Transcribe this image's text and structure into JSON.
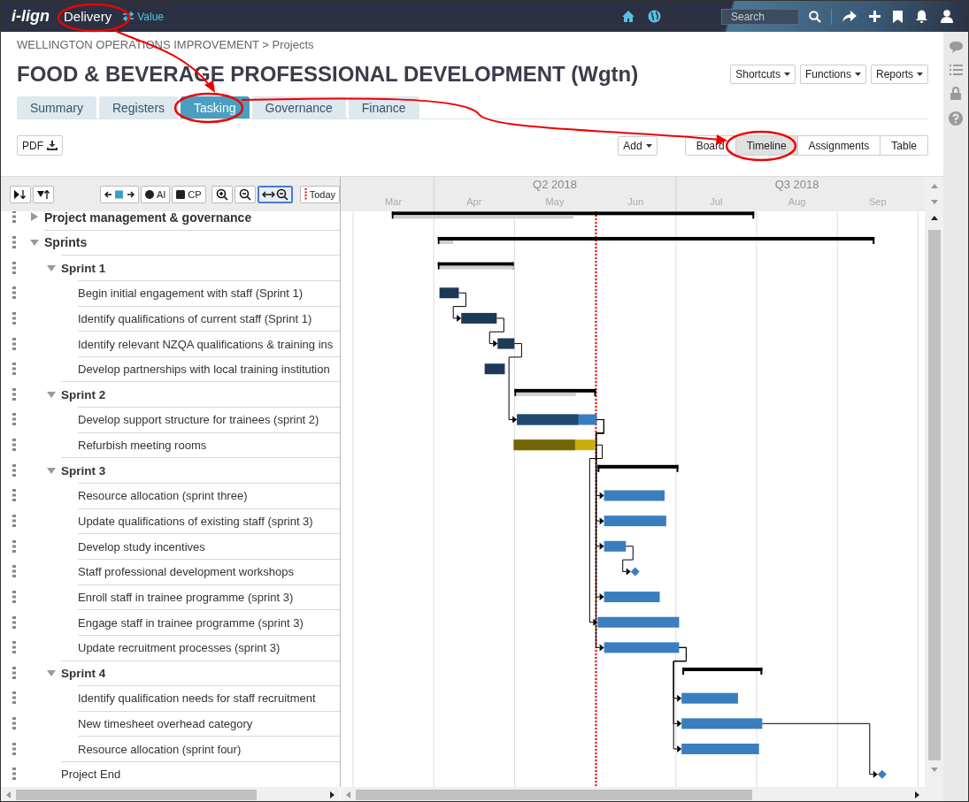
{
  "topbar": {
    "logo": "i-lign",
    "module": "Delivery",
    "switch_label": "Value",
    "search": {
      "placeholder": "Search"
    }
  },
  "breadcrumb": "WELLINGTON OPERATIONS IMPROVEMENT > Projects",
  "title": "FOOD & BEVERAGE PROFESSIONAL DEVELOPMENT (Wgtn)",
  "menus": [
    "Shortcuts",
    "Functions",
    "Reports"
  ],
  "tabs": [
    {
      "label": "Summary",
      "selected": false
    },
    {
      "label": "Registers",
      "selected": false
    },
    {
      "label": "Tasking",
      "selected": true
    },
    {
      "label": "Governance",
      "selected": false
    },
    {
      "label": "Finance",
      "selected": false
    }
  ],
  "pdf_button": "PDF",
  "add_button": "Add",
  "views": [
    {
      "label": "Board",
      "selected": false
    },
    {
      "label": "Timeline",
      "selected": true
    },
    {
      "label": "Assignments",
      "selected": false
    },
    {
      "label": "Table",
      "selected": false
    }
  ],
  "toolbar": {
    "ai_label": "AI",
    "cp_label": "CP",
    "today_label": "Today",
    "fit_selected": true
  },
  "tasks": [
    {
      "name": "Project management & governance",
      "kind": "summary",
      "expanded": false
    },
    {
      "name": "Sprints",
      "kind": "summary",
      "expanded": true,
      "children": [
        {
          "name": "Sprint 1",
          "kind": "summary",
          "expanded": true,
          "children": [
            {
              "name": "Begin initial engagement with staff (Sprint 1)",
              "kind": "task",
              "color": "#1c3a57"
            },
            {
              "name": "Identify qualifications of current staff (Sprint 1)",
              "kind": "task",
              "color": "#1c3a57"
            },
            {
              "name": "Identify relevant NZQA qualifications & training ins",
              "kind": "task",
              "color": "#1c3a57"
            },
            {
              "name": "Develop partnerships with local training institution",
              "kind": "task",
              "color": "#1c3a57"
            }
          ]
        },
        {
          "name": "Sprint 2",
          "kind": "summary",
          "expanded": true,
          "children": [
            {
              "name": "Develop support structure for trainees (sprint 2)",
              "kind": "task",
              "color": "#3a7ebf"
            },
            {
              "name": "Refurbish meeting rooms",
              "kind": "task",
              "color": "#c8ae0c"
            }
          ]
        },
        {
          "name": "Sprint 3",
          "kind": "summary",
          "expanded": true,
          "children": [
            {
              "name": "Resource allocation (sprint three)",
              "kind": "task",
              "color": "#3a7ebf"
            },
            {
              "name": "Update qualifications of existing staff (sprint 3)",
              "kind": "task",
              "color": "#3a7ebf"
            },
            {
              "name": "Develop study incentives",
              "kind": "task",
              "color": "#3a7ebf"
            },
            {
              "name": "Staff professional development workshops",
              "kind": "milestone",
              "color": "#3a7ebf"
            },
            {
              "name": "Enroll staff in trainee programme (sprint 3)",
              "kind": "task",
              "color": "#3a7ebf"
            },
            {
              "name": "Engage staff in trainee programme (sprint 3)",
              "kind": "task",
              "color": "#3a7ebf"
            },
            {
              "name": "Update recruitment processes (sprint 3)",
              "kind": "task",
              "color": "#3a7ebf"
            }
          ]
        },
        {
          "name": "Sprint 4",
          "kind": "summary",
          "expanded": true,
          "children": [
            {
              "name": "Identify qualification needs for staff recruitment",
              "kind": "task",
              "color": "#3a7ebf"
            },
            {
              "name": "New timesheet overhead category",
              "kind": "task",
              "color": "#3a7ebf"
            },
            {
              "name": "Resource allocation (sprint four)",
              "kind": "task",
              "color": "#3a7ebf"
            }
          ]
        },
        {
          "name": "Project End",
          "kind": "milestone",
          "color": "#3a7ebf"
        }
      ]
    }
  ],
  "timeline": {
    "quarters": [
      "Q2 2018",
      "Q3 2018"
    ],
    "months": [
      "Mar",
      "Apr",
      "May",
      "Jun",
      "Jul",
      "Aug",
      "Sep"
    ]
  }
}
